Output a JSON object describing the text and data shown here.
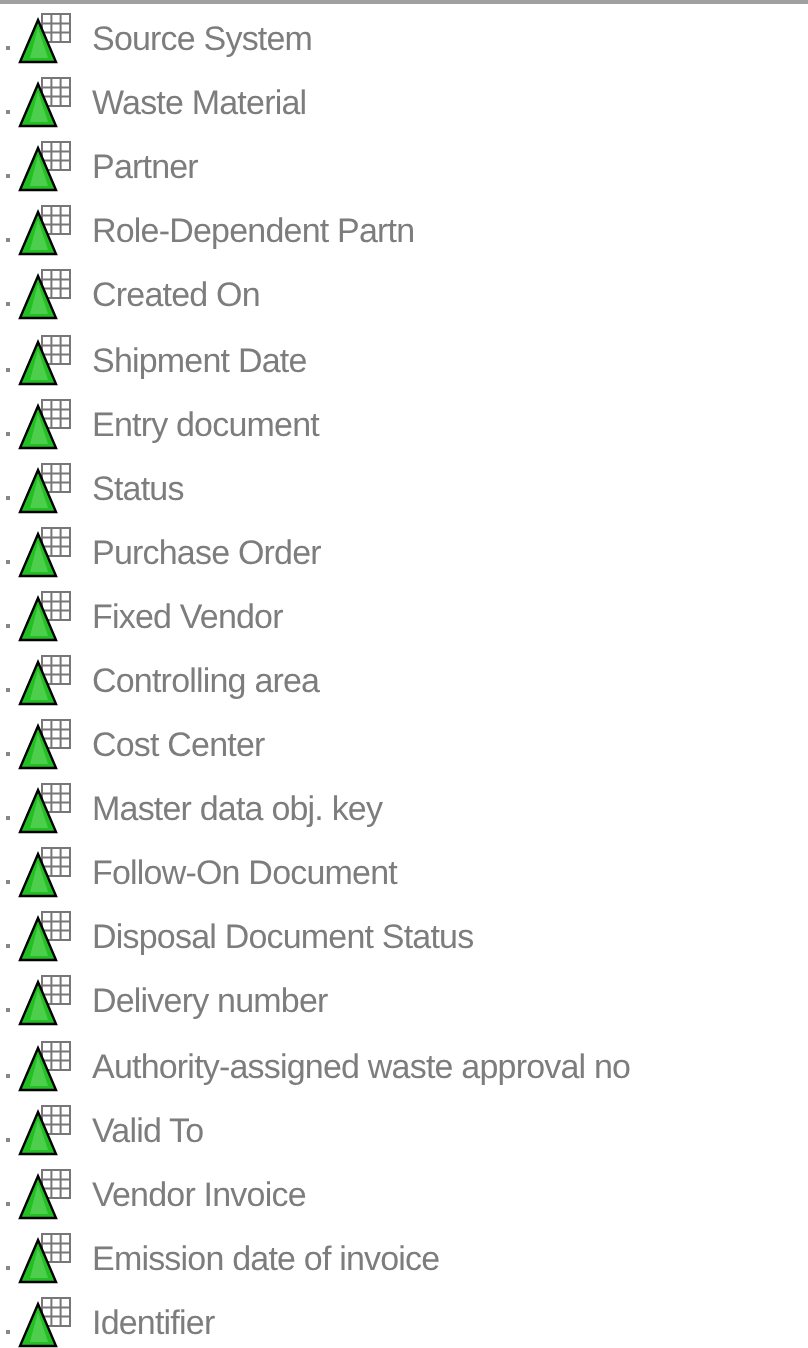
{
  "tree": {
    "items": [
      {
        "label": "Source System"
      },
      {
        "label": "Waste Material"
      },
      {
        "label": "Partner"
      },
      {
        "label": "Role-Dependent Partn"
      },
      {
        "label": "Created On"
      },
      {
        "label": "Shipment Date"
      },
      {
        "label": "Entry document"
      },
      {
        "label": "Status"
      },
      {
        "label": "Purchase Order"
      },
      {
        "label": "Fixed Vendor"
      },
      {
        "label": "Controlling area"
      },
      {
        "label": "Cost Center"
      },
      {
        "label": "Master data obj. key"
      },
      {
        "label": "Follow-On Document"
      },
      {
        "label": "Disposal Document Status"
      },
      {
        "label": "Delivery number"
      },
      {
        "label": "Authority-assigned waste approval no"
      },
      {
        "label": "Valid To"
      },
      {
        "label": "Vendor Invoice"
      },
      {
        "label": "Emission date of invoice"
      },
      {
        "label": "Identifier"
      }
    ]
  }
}
